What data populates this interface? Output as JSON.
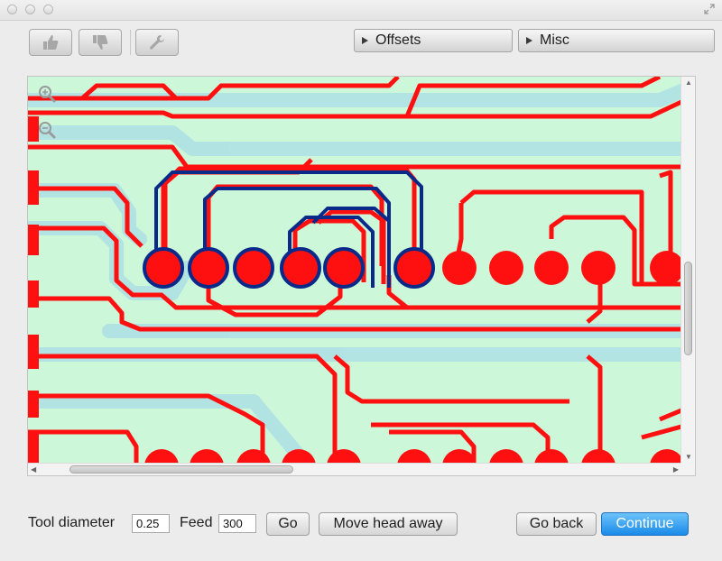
{
  "toolbar": {
    "icons": [
      "thumbs-up-icon",
      "thumbs-down-icon",
      "wrench-icon"
    ],
    "offsets_label": "Offsets",
    "misc_label": "Misc"
  },
  "board": {
    "zoom_in_icon": "zoom-in-icon",
    "zoom_out_icon": "zoom-out-icon",
    "colors": {
      "background": "#cdf7d9",
      "trace": "#ff0000",
      "highlight_trace": "#0a2a8a",
      "isolation_outline": "#9fd9ea"
    },
    "horizontal_scroll_fraction": 0.06,
    "vertical_scroll_fraction": 0.48
  },
  "footer": {
    "tool_diameter_label": "Tool diameter",
    "tool_diameter_value": "0.25",
    "feed_label": "Feed",
    "feed_value": "300",
    "go_label": "Go",
    "move_head_label": "Move head away",
    "go_back_label": "Go back",
    "continue_label": "Continue"
  },
  "colors": {
    "accent": "#1a8ae8",
    "window_bg": "#ececec"
  }
}
